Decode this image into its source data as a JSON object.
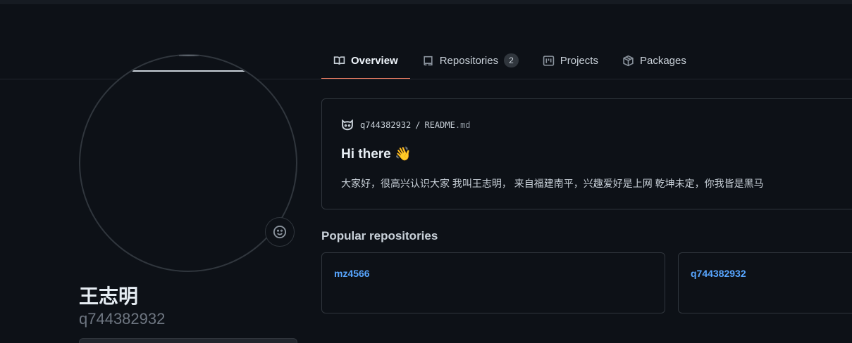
{
  "tabs": [
    {
      "label": "Overview",
      "icon": "book-icon",
      "selected": true
    },
    {
      "label": "Repositories",
      "icon": "repo-icon",
      "count": "2"
    },
    {
      "label": "Projects",
      "icon": "project-icon"
    },
    {
      "label": "Packages",
      "icon": "package-icon"
    }
  ],
  "profile": {
    "name": "王志明",
    "login": "q744382932",
    "status_icon": "smiley-icon"
  },
  "readme": {
    "owner": "q744382932",
    "separator": "/",
    "file_name": "README",
    "file_ext": ".md",
    "title": "Hi there 👋",
    "body": "大家好，很高兴认识大家 我叫王志明， 来自福建南平，兴趣爱好是上网 乾坤未定，你我皆是黑马"
  },
  "popular": {
    "title": "Popular repositories",
    "repos": [
      {
        "name": "mz4566"
      },
      {
        "name": "q744382932"
      }
    ]
  },
  "colors": {
    "background": "#0d1117",
    "accent_underline": "#f78166",
    "link": "#58a6ff",
    "border": "#30363d"
  }
}
